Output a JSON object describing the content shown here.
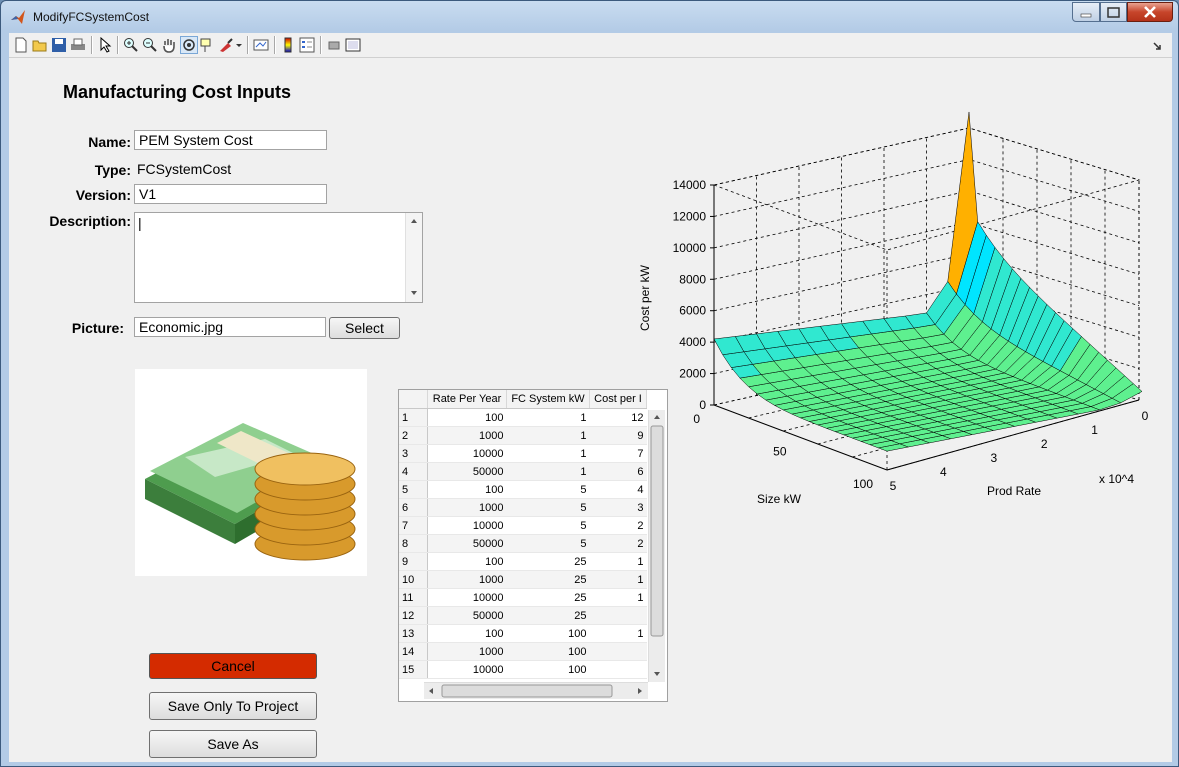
{
  "window": {
    "title": "ModifyFCSystemCost"
  },
  "heading": "Manufacturing Cost Inputs",
  "form": {
    "name_label": "Name:",
    "name_value": "PEM System Cost",
    "type_label": "Type:",
    "type_value": "FCSystemCost",
    "version_label": "Version:",
    "version_value": "V1",
    "description_label": "Description:",
    "description_value": "|",
    "picture_label": "Picture:",
    "picture_value": "Economic.jpg",
    "select_label": "Select"
  },
  "buttons": {
    "cancel": "Cancel",
    "save_project": "Save Only To Project",
    "save_as": "Save As"
  },
  "colors": {
    "cancel_bg": "#d42b00",
    "surface_top": "#00e5ff",
    "surface_bottom": "#5ef08f",
    "spike": "#ffb000"
  },
  "table": {
    "headers": [
      "Rate Per Year",
      "FC System kW",
      "Cost per I"
    ],
    "rows": [
      [
        "1",
        "100",
        "1",
        "12"
      ],
      [
        "2",
        "1000",
        "1",
        "9"
      ],
      [
        "3",
        "10000",
        "1",
        "7"
      ],
      [
        "4",
        "50000",
        "1",
        "6"
      ],
      [
        "5",
        "100",
        "5",
        "4"
      ],
      [
        "6",
        "1000",
        "5",
        "3"
      ],
      [
        "7",
        "10000",
        "5",
        "2"
      ],
      [
        "8",
        "50000",
        "5",
        "2"
      ],
      [
        "9",
        "100",
        "25",
        "1"
      ],
      [
        "10",
        "1000",
        "25",
        "1"
      ],
      [
        "11",
        "10000",
        "25",
        "1"
      ],
      [
        "12",
        "50000",
        "25",
        ""
      ],
      [
        "13",
        "100",
        "100",
        "1"
      ],
      [
        "14",
        "1000",
        "100",
        ""
      ],
      [
        "15",
        "10000",
        "100",
        ""
      ]
    ]
  },
  "chart_data": {
    "type": "surface3d",
    "zlabel": "Cost per kW",
    "xlabel": "Size kW",
    "ylabel": "Prod Rate",
    "y_exponent": "x 10^4",
    "z_ticks": [
      "0",
      "2000",
      "4000",
      "6000",
      "8000",
      "10000",
      "12000",
      "14000"
    ],
    "x_ticks": [
      "0",
      "50",
      "100"
    ],
    "y_ticks": [
      "5",
      "4",
      "3",
      "2",
      "1",
      "0"
    ],
    "zlim": [
      0,
      14000
    ],
    "grid": true
  }
}
